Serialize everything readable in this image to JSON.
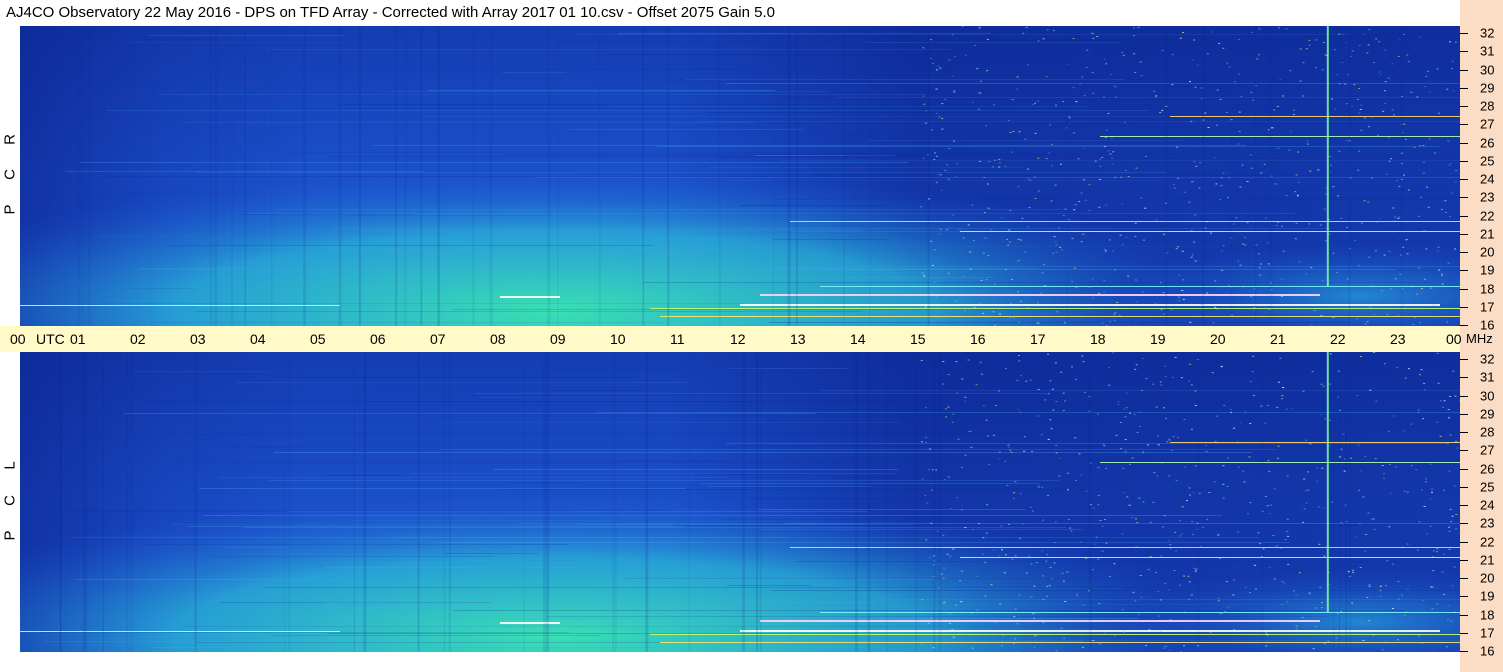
{
  "title": "AJ4CO Observatory  22 May 2016  -  DPS on TFD Array  -  Corrected with Array 2017 01 10.csv  -  Offset 2075  Gain 5.0",
  "chart_data": [
    {
      "type": "heatmap",
      "title": "RCP",
      "polarization_letters": [
        "R",
        "C",
        "P"
      ],
      "x_ticks": [
        "00",
        "01",
        "02",
        "03",
        "04",
        "05",
        "06",
        "07",
        "08",
        "09",
        "10",
        "11",
        "12",
        "13",
        "14",
        "15",
        "16",
        "17",
        "18",
        "19",
        "20",
        "21",
        "22",
        "23",
        "00"
      ],
      "x_unit": "UTC",
      "y_ticks": [
        "16",
        "17",
        "18",
        "19",
        "20",
        "21",
        "22",
        "23",
        "24",
        "25",
        "26",
        "27",
        "28",
        "29",
        "30",
        "31",
        "32"
      ],
      "y_unit": "MHz",
      "ylim": [
        16,
        32
      ],
      "colors": {
        "background": "#1d55d2",
        "dark": "#0a1f8a",
        "mid": "#2a7be6",
        "bright": "#3ae0b2",
        "hot": "#ffffff"
      }
    },
    {
      "type": "heatmap",
      "title": "LCP",
      "polarization_letters": [
        "L",
        "C",
        "P"
      ],
      "x_ticks": [
        "00",
        "01",
        "02",
        "03",
        "04",
        "05",
        "06",
        "07",
        "08",
        "09",
        "10",
        "11",
        "12",
        "13",
        "14",
        "15",
        "16",
        "17",
        "18",
        "19",
        "20",
        "21",
        "22",
        "23",
        "00"
      ],
      "x_unit": "UTC",
      "y_ticks": [
        "16",
        "17",
        "18",
        "19",
        "20",
        "21",
        "22",
        "23",
        "24",
        "25",
        "26",
        "27",
        "28",
        "29",
        "30",
        "31",
        "32"
      ],
      "y_unit": "MHz",
      "ylim": [
        16,
        32
      ],
      "colors": {
        "background": "#1d55d2",
        "dark": "#0a1f8a",
        "mid": "#2a7be6",
        "bright": "#3ae0b2",
        "hot": "#ffffff"
      }
    }
  ],
  "time_axis": {
    "hours": [
      "00",
      "01",
      "02",
      "03",
      "04",
      "05",
      "06",
      "07",
      "08",
      "09",
      "10",
      "11",
      "12",
      "13",
      "14",
      "15",
      "16",
      "17",
      "18",
      "19",
      "20",
      "21",
      "22",
      "23",
      "00"
    ],
    "utc_label": "UTC",
    "mhz_label": "MHz"
  }
}
